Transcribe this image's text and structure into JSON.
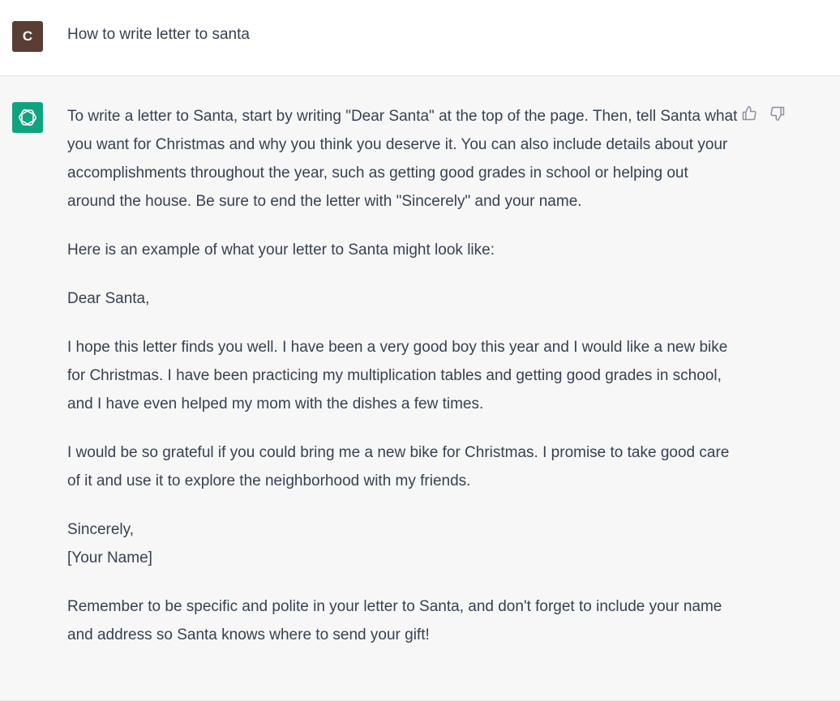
{
  "user_message": {
    "avatar_letter": "C",
    "text": "How to write letter to santa"
  },
  "assistant_message": {
    "paragraphs": [
      "To write a letter to Santa, start by writing \"Dear Santa\" at the top of the page. Then, tell Santa what you want for Christmas and why you think you deserve it. You can also include details about your accomplishments throughout the year, such as getting good grades in school or helping out around the house. Be sure to end the letter with \"Sincerely\" and your name.",
      "Here is an example of what your letter to Santa might look like:",
      "Dear Santa,",
      "I hope this letter finds you well. I have been a very good boy this year and I would like a new bike for Christmas. I have been practicing my multiplication tables and getting good grades in school, and I have even helped my mom with the dishes a few times.",
      "I would be so grateful if you could bring me a new bike for Christmas. I promise to take good care of it and use it to explore the neighborhood with my friends.",
      "Sincerely,\n[Your Name]",
      "Remember to be specific and polite in your letter to Santa, and don't forget to include your name and address so Santa knows where to send your gift!"
    ]
  },
  "icons": {
    "assistant_logo": "openai-logo-icon",
    "thumbs_up": "thumbs-up-icon",
    "thumbs_down": "thumbs-down-icon"
  },
  "colors": {
    "user_avatar_bg": "#5a3e36",
    "assistant_avatar_bg": "#10a37f",
    "assistant_row_bg": "#f7f7f8",
    "text": "#374151"
  }
}
